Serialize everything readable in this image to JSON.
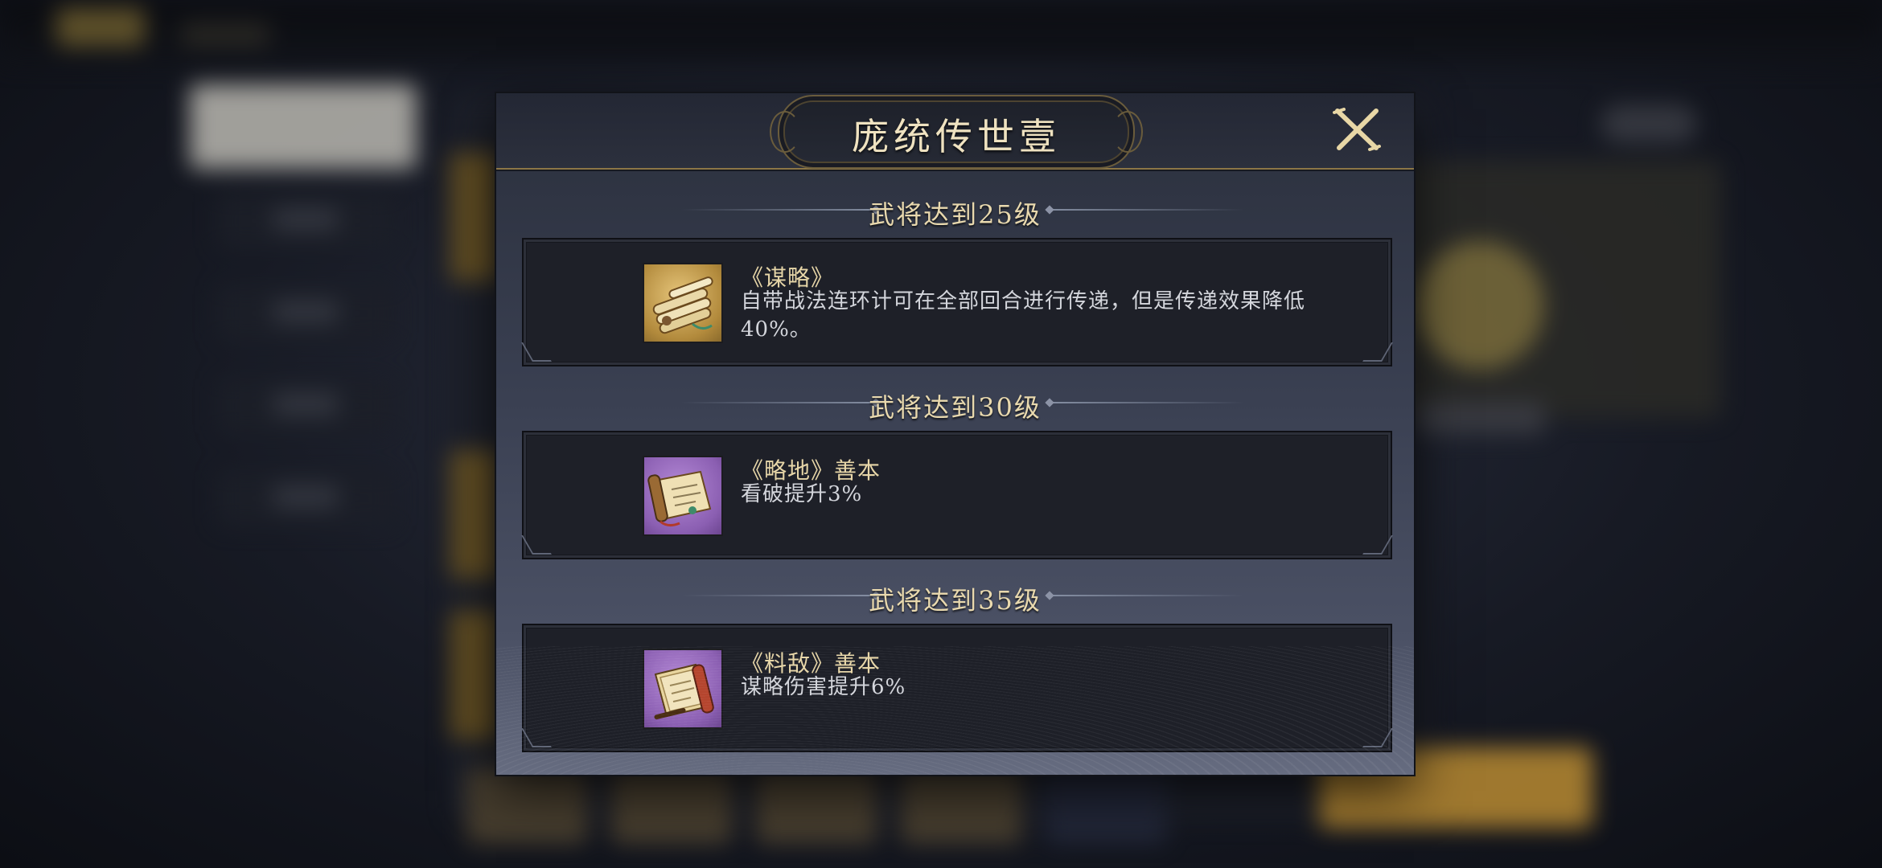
{
  "modal": {
    "title": "庞统传世壹",
    "close_icon": "close-x-icon"
  },
  "tiers": [
    {
      "requirement": "武将达到25级",
      "item_name": "《谋略》",
      "item_desc": "自带战法连环计可在全部回合进行传递，但是传递效果降低40%。",
      "icon": "bamboo-scroll-bundle-icon",
      "icon_frame": "gold"
    },
    {
      "requirement": "武将达到30级",
      "item_name": "《略地》善本",
      "item_desc": "看破提升3%",
      "icon": "open-scroll-icon",
      "icon_frame": "purple"
    },
    {
      "requirement": "武将达到35级",
      "item_name": "《料敌》善本",
      "item_desc": "谋略伤害提升6%",
      "icon": "book-scroll-icon",
      "icon_frame": "purple"
    }
  ],
  "colors": {
    "title_text": "#efe2c0",
    "requirement_text": "#e9d9ae",
    "item_name_text": "#e7d6a8",
    "desc_text": "#d4d6dc",
    "gold_frame": "#b28a3c",
    "purple_frame": "#8b5fb2"
  }
}
